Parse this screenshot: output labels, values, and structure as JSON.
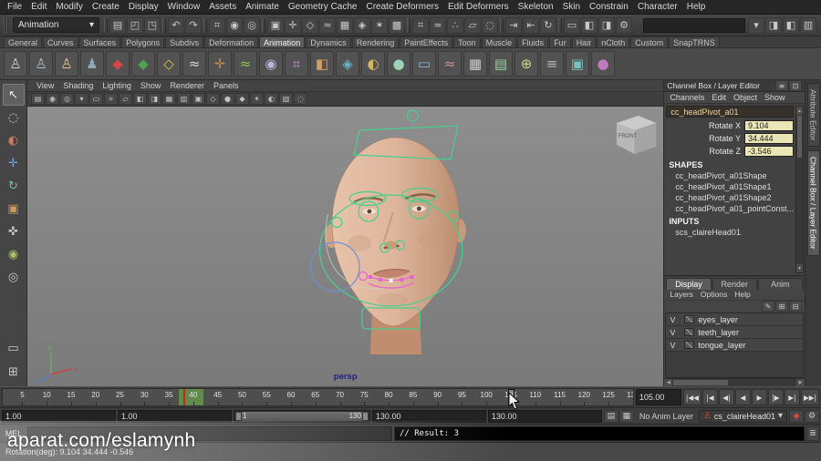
{
  "colors": {
    "viewport_bg_top": "#8e8e8e",
    "viewport_bg_bottom": "#7a7a7a",
    "rig_control_green": "#46d08e",
    "rig_control_magenta": "#e95fd5",
    "rig_control_blue": "#6f8fd2",
    "keyed_channel_value_bg": "#e9e5b4",
    "selected_range_green": "#70be48",
    "character_set_red": "#d04a3a",
    "skin_light": "#e7c3ab",
    "skin_dark": "#bd8e70"
  },
  "menubar": {
    "items": [
      "File",
      "Edit",
      "Modify",
      "Create",
      "Display",
      "Window",
      "Assets",
      "Animate",
      "Geometry Cache",
      "Create Deformers",
      "Edit Deformers",
      "Skeleton",
      "Skin",
      "Constrain",
      "Character",
      "Help"
    ]
  },
  "statusline": {
    "mode_selector": "Animation",
    "selection_field_value": "",
    "groups": [
      {
        "name": "scene",
        "icons": [
          {
            "n": "new-scene-icon",
            "g": "▤"
          },
          {
            "n": "open-scene-icon",
            "g": "◰"
          },
          {
            "n": "save-scene-icon",
            "g": "◳"
          }
        ]
      },
      {
        "name": "undo-redo",
        "icons": [
          {
            "n": "undo-icon",
            "g": "↶"
          },
          {
            "n": "redo-icon",
            "g": "↷"
          }
        ]
      },
      {
        "name": "selection-mode",
        "icons": [
          {
            "n": "select-hierarchy-icon",
            "g": "⌗"
          },
          {
            "n": "select-object-icon",
            "g": "◉"
          },
          {
            "n": "select-component-icon",
            "g": "◎"
          }
        ]
      },
      {
        "name": "selection-masks",
        "icons": [
          {
            "n": "select-all-mask-icon",
            "g": "▣"
          },
          {
            "n": "select-handles-icon",
            "g": "✛"
          },
          {
            "n": "select-joints-icon",
            "g": "◇"
          },
          {
            "n": "select-curves-icon",
            "g": "≈"
          },
          {
            "n": "select-surfaces-icon",
            "g": "▦"
          },
          {
            "n": "select-deformations-icon",
            "g": "◈"
          },
          {
            "n": "select-dynamics-icon",
            "g": "✶"
          },
          {
            "n": "select-rendering-icon",
            "g": "▩"
          }
        ]
      },
      {
        "name": "snapping",
        "icons": [
          {
            "n": "snap-to-grid-icon",
            "g": "⌗"
          },
          {
            "n": "snap-to-curve-icon",
            "g": "≈"
          },
          {
            "n": "snap-to-point-icon",
            "g": "∴"
          },
          {
            "n": "snap-to-plane-icon",
            "g": "▱"
          },
          {
            "n": "make-live-icon",
            "g": "◌"
          }
        ]
      },
      {
        "name": "history",
        "icons": [
          {
            "n": "input-connections-icon",
            "g": "⇥"
          },
          {
            "n": "output-connections-icon",
            "g": "⇤"
          },
          {
            "n": "construction-history-icon",
            "g": "↻"
          }
        ]
      },
      {
        "name": "render",
        "icons": [
          {
            "n": "render-view-icon",
            "g": "▭"
          },
          {
            "n": "render-current-frame-icon",
            "g": "◧"
          },
          {
            "n": "ipr-render-icon",
            "g": "◨"
          },
          {
            "n": "render-settings-icon",
            "g": "⚙"
          }
        ]
      }
    ],
    "right_icons": [
      {
        "n": "quick-selection-set-icon",
        "g": "▾"
      },
      {
        "n": "sidebar-attribute-editor-icon",
        "g": "◨"
      },
      {
        "n": "sidebar-tool-settings-icon",
        "g": "◧"
      },
      {
        "n": "sidebar-channel-box-icon",
        "g": "▥"
      }
    ]
  },
  "shelf": {
    "tabs": [
      "General",
      "Curves",
      "Surfaces",
      "Polygons",
      "Subdivs",
      "Deformation",
      "Animation",
      "Dynamics",
      "Rendering",
      "PaintEffects",
      "Toon",
      "Muscle",
      "Fluids",
      "Fur",
      "Hair",
      "nCloth",
      "Custom",
      "SnapTRNS"
    ],
    "active_tab": "Animation",
    "icons": [
      {
        "n": "shelf-select-character-icon",
        "g": "♙",
        "c": "#c6cfd8"
      },
      {
        "n": "shelf-character-set-icon",
        "g": "♙",
        "c": "#a8bac8"
      },
      {
        "n": "shelf-subcharacter-icon",
        "g": "♙",
        "c": "#d8c88a"
      },
      {
        "n": "shelf-character-member-icon",
        "g": "♟",
        "c": "#8fa6b6"
      },
      {
        "n": "shelf-set-key-icon",
        "g": "◆",
        "c": "#d24848"
      },
      {
        "n": "shelf-set-breakdown-icon",
        "g": "◆",
        "c": "#4aa34e"
      },
      {
        "n": "shelf-set-driven-key-icon",
        "g": "◇",
        "c": "#d2c44a"
      },
      {
        "n": "shelf-motion-trail-icon",
        "g": "≈",
        "c": "#d8d8d8"
      },
      {
        "n": "shelf-ik-handle-icon",
        "g": "✛",
        "c": "#c68c4a"
      },
      {
        "n": "shelf-spline-ik-icon",
        "g": "≈",
        "c": "#90c64a"
      },
      {
        "n": "shelf-cluster-icon",
        "g": "◉",
        "c": "#b6b6da"
      },
      {
        "n": "shelf-lattice-icon",
        "g": "⌗",
        "c": "#c69cd2"
      },
      {
        "n": "shelf-blend-shape-icon",
        "g": "◧",
        "c": "#d29c66"
      },
      {
        "n": "shelf-wrap-deformer-icon",
        "g": "◈",
        "c": "#66b6d2"
      },
      {
        "n": "shelf-sculpt-deformer-icon",
        "g": "◐",
        "c": "#d2b666"
      },
      {
        "n": "shelf-jiggle-deformer-icon",
        "g": "●",
        "c": "#9cd2b6"
      },
      {
        "n": "shelf-playblast-icon",
        "g": "▭",
        "c": "#8cb6da"
      },
      {
        "n": "shelf-graph-editor-icon",
        "g": "≈",
        "c": "#da8c8c"
      },
      {
        "n": "shelf-dope-sheet-icon",
        "g": "▦",
        "c": "#cccccc"
      },
      {
        "n": "shelf-trax-editor-icon",
        "g": "▤",
        "c": "#9cd2a0"
      },
      {
        "n": "shelf-constraint-icon",
        "g": "⊕",
        "c": "#d2d28c"
      },
      {
        "n": "shelf-expression-editor-icon",
        "g": "≡",
        "c": "#b4b4b4"
      },
      {
        "n": "shelf-create-clip-icon",
        "g": "▣",
        "c": "#7ac2c2"
      },
      {
        "n": "shelf-create-pose-icon",
        "g": "●",
        "c": "#c27ac2"
      }
    ]
  },
  "toolbox": {
    "tools": [
      {
        "n": "select-tool",
        "g": "↖",
        "c": "#ececec",
        "active": true
      },
      {
        "n": "lasso-tool",
        "g": "◌",
        "c": "#d8d8d8",
        "active": false
      },
      {
        "n": "paint-selection-tool",
        "g": "◐",
        "c": "#cc7a5a",
        "active": false
      },
      {
        "n": "move-tool",
        "g": "✛",
        "c": "#7aa0dd",
        "active": false
      },
      {
        "n": "rotate-tool",
        "g": "↻",
        "c": "#6ac0a8",
        "active": false
      },
      {
        "n": "scale-tool",
        "g": "▣",
        "c": "#cc9a5a",
        "active": false
      },
      {
        "n": "universal-manipulator-tool",
        "g": "✜",
        "c": "#c8c8c8",
        "active": false
      },
      {
        "n": "soft-modification-tool",
        "g": "◉",
        "c": "#a8c06a",
        "active": false
      },
      {
        "n": "show-manipulator-tool",
        "g": "◎",
        "c": "#c8c8c8",
        "active": false
      }
    ],
    "layouts": [
      {
        "n": "single-pane-layout-button",
        "g": "▭"
      },
      {
        "n": "four-pane-layout-button",
        "g": "⊞"
      }
    ]
  },
  "viewport": {
    "menu": [
      "View",
      "Shading",
      "Lighting",
      "Show",
      "Renderer",
      "Panels"
    ],
    "toolbar_icons": [
      {
        "n": "select-camera-icon",
        "g": "▤"
      },
      {
        "n": "lock-camera-icon",
        "g": "◉"
      },
      {
        "n": "camera-attributes-icon",
        "g": "◎"
      },
      {
        "n": "bookmark-icon",
        "g": "▾"
      },
      {
        "n": "image-plane-icon",
        "g": "▭"
      },
      {
        "n": "view-grid-icon",
        "g": "⌗"
      },
      {
        "n": "film-gate-icon",
        "g": "▱"
      },
      {
        "n": "resolution-gate-icon",
        "g": "◧"
      },
      {
        "n": "gate-mask-icon",
        "g": "◨"
      },
      {
        "n": "field-chart-icon",
        "g": "▦"
      },
      {
        "n": "safe-action-icon",
        "g": "▥"
      },
      {
        "n": "safe-title-icon",
        "g": "▣"
      },
      {
        "n": "wireframe-mode-icon",
        "g": "◇"
      },
      {
        "n": "smooth-shade-mode-icon",
        "g": "●"
      },
      {
        "n": "textured-mode-icon",
        "g": "◆"
      },
      {
        "n": "use-lights-icon",
        "g": "✶"
      },
      {
        "n": "shadows-icon",
        "g": "◐"
      },
      {
        "n": "xray-icon",
        "g": "▨"
      },
      {
        "n": "isolate-select-icon",
        "g": "◌"
      }
    ],
    "camera_label": "persp",
    "viewcube_front_label": "FRONT",
    "axis_labels": [
      "y",
      "x",
      "z"
    ]
  },
  "channel_box": {
    "title": "Channel Box / Layer Editor",
    "title_icons": [
      {
        "n": "channel-box-display-icon",
        "g": "≡"
      },
      {
        "n": "pin-panel-icon",
        "g": "⊡"
      }
    ],
    "menu": [
      "Channels",
      "Edit",
      "Object",
      "Show"
    ],
    "object_name": "cc_headPivot_a01",
    "attributes": [
      {
        "label": "Rotate X",
        "value": "9.104"
      },
      {
        "label": "Rotate Y",
        "value": "34.444"
      },
      {
        "label": "Rotate Z",
        "value": "-3.546"
      }
    ],
    "shapes_header": "SHAPES",
    "shapes": [
      "cc_headPivot_a01Shape",
      "cc_headPivot_a01Shape1",
      "cc_headPivot_a01Shape2",
      "cc_headPivot_a01_pointConst..."
    ],
    "inputs_header": "INPUTS",
    "inputs": [
      "scs_claireHead01"
    ]
  },
  "layer_editor": {
    "tabs": [
      "Display",
      "Render",
      "Anim"
    ],
    "active_tab": "Display",
    "menu": [
      "Layers",
      "Options",
      "Help"
    ],
    "toolbar_icons": [
      {
        "n": "edit-layer-icon",
        "g": "✎"
      },
      {
        "n": "new-empty-layer-icon",
        "g": "⊞"
      },
      {
        "n": "new-layer-from-selection-icon",
        "g": "⊟"
      }
    ],
    "layers": [
      {
        "visible": "V",
        "name": "eyes_layer"
      },
      {
        "visible": "V",
        "name": "teeth_layer"
      },
      {
        "visible": "V",
        "name": "tongue_layer"
      }
    ]
  },
  "side_tabs": [
    {
      "label": "Attribute Editor",
      "active": false
    },
    {
      "label": "Channel Box / Layer Editor",
      "active": true
    }
  ],
  "timeline": {
    "start": 1,
    "end": 130,
    "label_step": 5,
    "current_frame": 105,
    "current_time_field": "105.00",
    "range_highlight": {
      "start": 37,
      "end": 42
    },
    "key_tick": 38,
    "playback_buttons": [
      {
        "n": "go-to-start-button",
        "g": "|◀◀"
      },
      {
        "n": "step-back-key-button",
        "g": "|◀"
      },
      {
        "n": "step-back-frame-button",
        "g": "◀|"
      },
      {
        "n": "play-backwards-button",
        "g": "◀"
      },
      {
        "n": "play-forwards-button",
        "g": "▶"
      },
      {
        "n": "step-forward-frame-button",
        "g": "|▶"
      },
      {
        "n": "step-forward-key-button",
        "g": "▶|"
      },
      {
        "n": "go-to-end-button",
        "g": "▶▶|"
      }
    ]
  },
  "range_slider": {
    "animation_start": "1.00",
    "playback_start": "1.00",
    "bar_start_label": "1",
    "bar_end_label": "130",
    "playback_end": "130.00",
    "animation_end": "130.00",
    "layer_icons": [
      {
        "n": "anim-layer-filter-icon",
        "g": "▤"
      },
      {
        "n": "anim-layer-weight-icon",
        "g": "▦"
      }
    ],
    "anim_layer_label": "No Anim Layer",
    "character_set": "cs_claireHead01",
    "end_icons": [
      {
        "n": "auto-keyframe-toggle",
        "g": "◆"
      },
      {
        "n": "animation-preferences-button",
        "g": "⚙"
      }
    ]
  },
  "command_line": {
    "label": "MEL",
    "input_value": "",
    "result": "// Result: 3"
  },
  "help_line": {
    "text": "Rotation(deg): 9.104  34.444  -0.546"
  },
  "watermark": {
    "text": "aparat.com/eslamynh"
  }
}
